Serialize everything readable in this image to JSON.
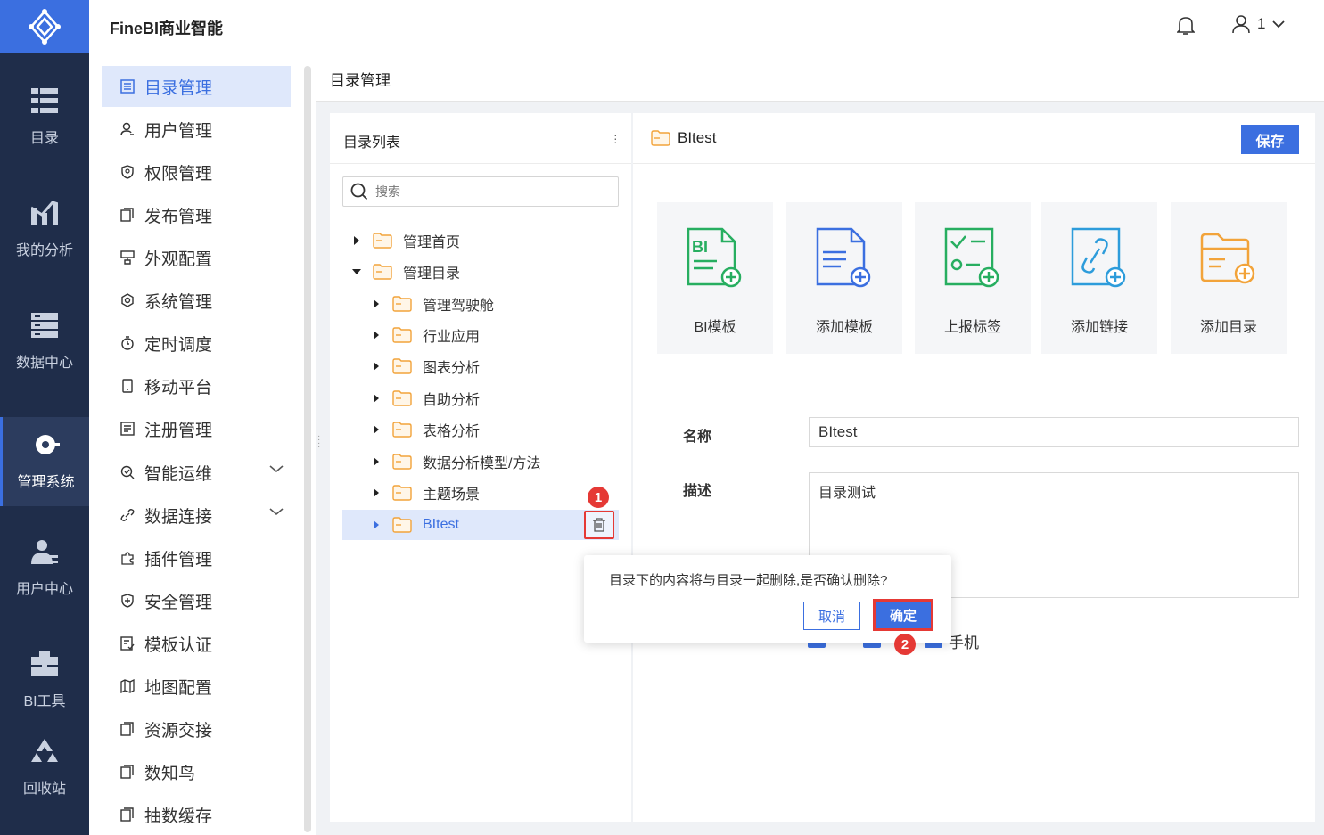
{
  "app": {
    "brand": "FineBI商业智能",
    "user": "1"
  },
  "leftnav": [
    {
      "label": "目录",
      "icon": "list-icon"
    },
    {
      "label": "我的分析",
      "icon": "chart-icon"
    },
    {
      "label": "数据中心",
      "icon": "database-icon"
    },
    {
      "label": "管理系统",
      "icon": "gear-icon"
    },
    {
      "label": "用户中心",
      "icon": "user-icon"
    },
    {
      "label": "BI工具",
      "icon": "toolbox-icon"
    },
    {
      "label": "回收站",
      "icon": "recycle-icon"
    }
  ],
  "sidemenu": [
    {
      "label": "目录管理",
      "icon": "catalog-icon"
    },
    {
      "label": "用户管理",
      "icon": "user-icon"
    },
    {
      "label": "权限管理",
      "icon": "permission-icon"
    },
    {
      "label": "发布管理",
      "icon": "publish-icon"
    },
    {
      "label": "外观配置",
      "icon": "appearance-icon"
    },
    {
      "label": "系统管理",
      "icon": "settings-icon"
    },
    {
      "label": "定时调度",
      "icon": "clock-icon"
    },
    {
      "label": "移动平台",
      "icon": "mobile-icon"
    },
    {
      "label": "注册管理",
      "icon": "register-icon"
    },
    {
      "label": "智能运维",
      "icon": "ops-icon"
    },
    {
      "label": "数据连接",
      "icon": "link-icon"
    },
    {
      "label": "插件管理",
      "icon": "plugin-icon"
    },
    {
      "label": "安全管理",
      "icon": "shield-icon"
    },
    {
      "label": "模板认证",
      "icon": "template-icon"
    },
    {
      "label": "地图配置",
      "icon": "map-icon"
    },
    {
      "label": "资源交接",
      "icon": "resource-icon"
    },
    {
      "label": "数知鸟",
      "icon": "bird-icon"
    },
    {
      "label": "抽数缓存",
      "icon": "cache-icon"
    }
  ],
  "main": {
    "title": "目录管理"
  },
  "tree": {
    "title": "目录列表",
    "search_placeholder": "搜索",
    "nodes": [
      {
        "label": "管理首页"
      },
      {
        "label": "管理目录"
      },
      {
        "label": "管理驾驶舱"
      },
      {
        "label": "行业应用"
      },
      {
        "label": "图表分析"
      },
      {
        "label": "自助分析"
      },
      {
        "label": "表格分析"
      },
      {
        "label": "数据分析模型/方法"
      },
      {
        "label": "主题场景"
      },
      {
        "label": "BItest"
      }
    ]
  },
  "detail": {
    "name": "BItest",
    "save_label": "保存",
    "cards": [
      {
        "label": "BI模板",
        "color": "#27ae60"
      },
      {
        "label": "添加模板",
        "color": "#3b6fe0"
      },
      {
        "label": "上报标签",
        "color": "#27ae60"
      },
      {
        "label": "添加链接",
        "color": "#2d9cdb"
      },
      {
        "label": "添加目录",
        "color": "#f2a33a"
      }
    ],
    "name_label": "名称",
    "name_value": "BItest",
    "desc_label": "描述",
    "desc_value": "目录测试",
    "device_option": "手机"
  },
  "popup": {
    "message": "目录下的内容将与目录一起删除,是否确认删除?",
    "cancel": "取消",
    "ok": "确定"
  },
  "badges": [
    "1",
    "2"
  ],
  "colors": {
    "accent": "#3b6fe0",
    "nav_bg": "#1f2d4a",
    "highlight": "#e53935"
  }
}
